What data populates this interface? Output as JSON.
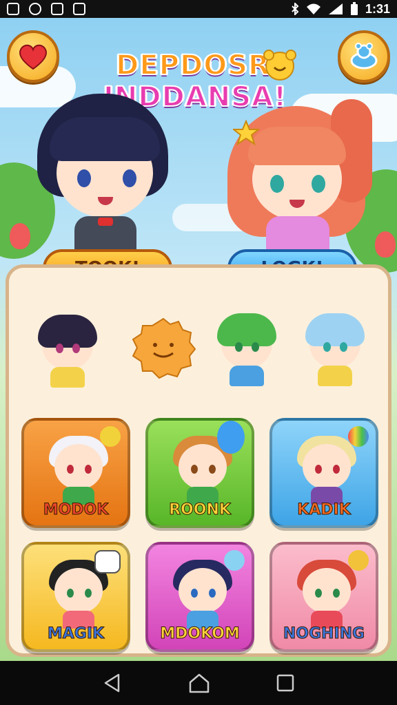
{
  "status_bar": {
    "time": "1:31",
    "left_icons": [
      "app-icon",
      "chrome-icon",
      "gallery-icon",
      "cat-icon"
    ],
    "right_icons": [
      "bluetooth-icon",
      "wifi-icon",
      "signal-icon",
      "battery-icon"
    ]
  },
  "header": {
    "favorite_icon": "heart-icon",
    "profile_icon": "character-icon"
  },
  "logo": {
    "line1": "DEPDOSR",
    "line2": "INDDANSA!"
  },
  "actions": {
    "left_label": "TOOK!",
    "right_label": "LOGK!"
  },
  "colors": {
    "orange_tile": "#f28a1e",
    "green_tile": "#7ccc3a",
    "blue_tile": "#58b8ee",
    "yellow_tile": "#fbc93a",
    "pink_tile": "#e35fc6",
    "rose_tile": "#f6a0b8"
  },
  "tiles": [
    {
      "label": "MODOK",
      "label_color": "#e8452a"
    },
    {
      "label": "ROONK",
      "label_color": "#ffd43a"
    },
    {
      "label": "KADIK",
      "label_color": "#f26a24"
    },
    {
      "label": "MAGIK",
      "label_color": "#3c74d8"
    },
    {
      "label": "MDOKOM",
      "label_color": "#ffd43a"
    },
    {
      "label": "NOGHING",
      "label_color": "#3c74d8"
    }
  ],
  "nav": {
    "back_icon": "back-icon",
    "home_icon": "home-icon",
    "recents_icon": "recents-icon"
  }
}
